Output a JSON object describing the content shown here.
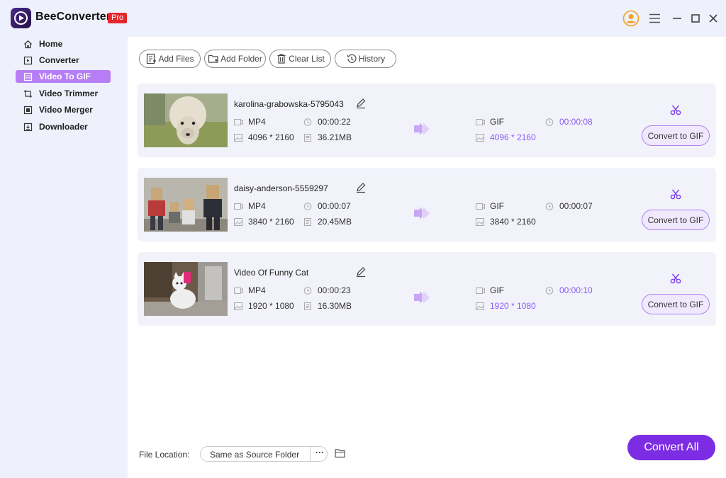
{
  "app": {
    "name": "BeeConverter",
    "badge": "Pro"
  },
  "window_controls": [
    "user-icon",
    "menu-icon",
    "minimize-icon",
    "maximize-icon",
    "close-icon"
  ],
  "sidebar": {
    "items": [
      {
        "label": "Home",
        "icon": "home-icon",
        "active": false
      },
      {
        "label": "Converter",
        "icon": "converter-icon",
        "active": false
      },
      {
        "label": "Video To GIF",
        "icon": "gif-icon",
        "active": true
      },
      {
        "label": "Video Trimmer",
        "icon": "trimmer-icon",
        "active": false
      },
      {
        "label": "Video Merger",
        "icon": "merger-icon",
        "active": false
      },
      {
        "label": "Downloader",
        "icon": "download-icon",
        "active": false
      }
    ]
  },
  "toolbar": {
    "add_files": "Add Files",
    "add_folder": "Add Folder",
    "clear_list": "Clear List",
    "history": "History"
  },
  "files": [
    {
      "name": "karolina-grabowska-5795043",
      "src_format": "MP4",
      "src_duration": "00:00:22",
      "src_resolution": "4096 * 2160",
      "src_size": "36.21MB",
      "out_format": "GIF",
      "out_duration": "00:00:08",
      "out_resolution": "4096 * 2160",
      "convert_label": "Convert to GIF",
      "thumbnail": "alpaca"
    },
    {
      "name": "daisy-anderson-5559297",
      "src_format": "MP4",
      "src_duration": "00:00:07",
      "src_resolution": "3840 * 2160",
      "src_size": "20.45MB",
      "out_format": "GIF",
      "out_duration": "00:00:07",
      "out_resolution": "3840 * 2160",
      "convert_label": "Convert to GIF",
      "thumbnail": "box-heads"
    },
    {
      "name": "Video Of Funny Cat",
      "src_format": "MP4",
      "src_duration": "00:00:23",
      "src_resolution": "1920 * 1080",
      "src_size": "16.30MB",
      "out_format": "GIF",
      "out_duration": "00:00:10",
      "out_resolution": "1920 * 1080",
      "convert_label": "Convert to GIF",
      "thumbnail": "cat"
    }
  ],
  "footer": {
    "location_label": "File Location:",
    "location_value": "Same as Source Folder",
    "more": "···",
    "convert_all": "Convert All"
  },
  "colors": {
    "accent": "#7c2de3",
    "active_nav": "#b57ef5",
    "purple_text": "#8b5cf6",
    "badge": "#e4262a"
  }
}
